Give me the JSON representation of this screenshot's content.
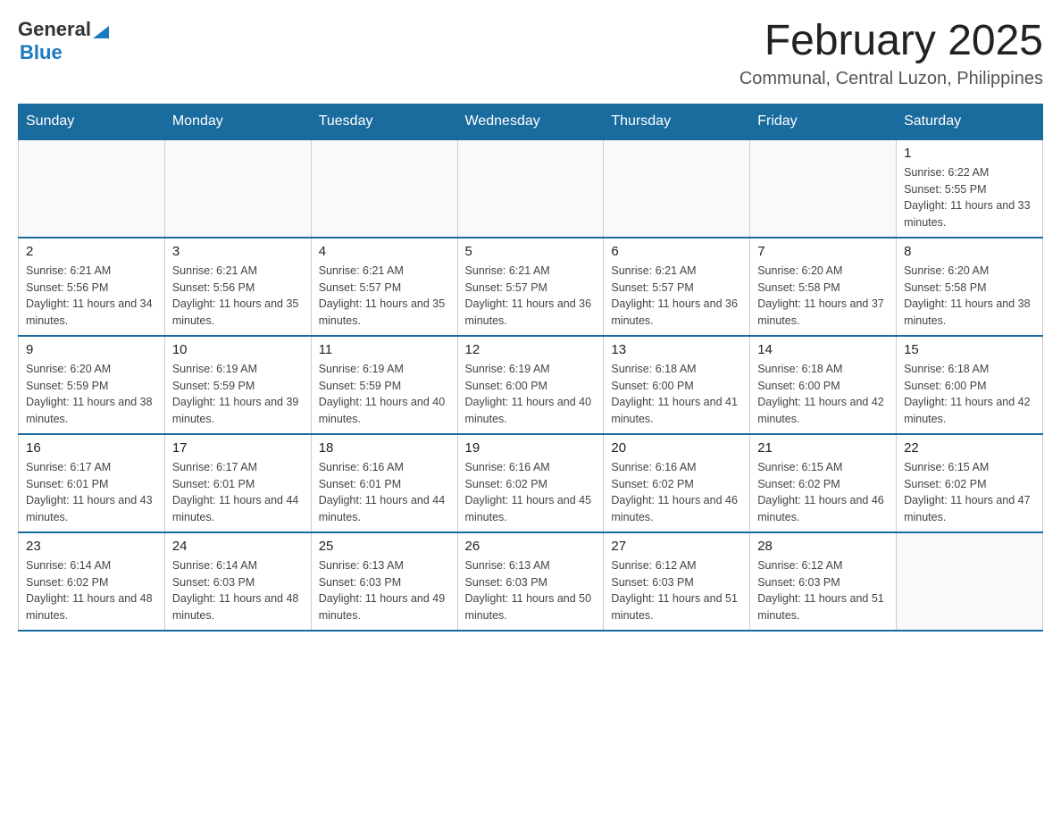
{
  "header": {
    "logo": {
      "general": "General",
      "arrow": "▶",
      "blue": "Blue"
    },
    "title": "February 2025",
    "location": "Communal, Central Luzon, Philippines"
  },
  "calendar": {
    "weekdays": [
      "Sunday",
      "Monday",
      "Tuesday",
      "Wednesday",
      "Thursday",
      "Friday",
      "Saturday"
    ],
    "weeks": [
      [
        {
          "day": "",
          "info": ""
        },
        {
          "day": "",
          "info": ""
        },
        {
          "day": "",
          "info": ""
        },
        {
          "day": "",
          "info": ""
        },
        {
          "day": "",
          "info": ""
        },
        {
          "day": "",
          "info": ""
        },
        {
          "day": "1",
          "info": "Sunrise: 6:22 AM\nSunset: 5:55 PM\nDaylight: 11 hours and 33 minutes."
        }
      ],
      [
        {
          "day": "2",
          "info": "Sunrise: 6:21 AM\nSunset: 5:56 PM\nDaylight: 11 hours and 34 minutes."
        },
        {
          "day": "3",
          "info": "Sunrise: 6:21 AM\nSunset: 5:56 PM\nDaylight: 11 hours and 35 minutes."
        },
        {
          "day": "4",
          "info": "Sunrise: 6:21 AM\nSunset: 5:57 PM\nDaylight: 11 hours and 35 minutes."
        },
        {
          "day": "5",
          "info": "Sunrise: 6:21 AM\nSunset: 5:57 PM\nDaylight: 11 hours and 36 minutes."
        },
        {
          "day": "6",
          "info": "Sunrise: 6:21 AM\nSunset: 5:57 PM\nDaylight: 11 hours and 36 minutes."
        },
        {
          "day": "7",
          "info": "Sunrise: 6:20 AM\nSunset: 5:58 PM\nDaylight: 11 hours and 37 minutes."
        },
        {
          "day": "8",
          "info": "Sunrise: 6:20 AM\nSunset: 5:58 PM\nDaylight: 11 hours and 38 minutes."
        }
      ],
      [
        {
          "day": "9",
          "info": "Sunrise: 6:20 AM\nSunset: 5:59 PM\nDaylight: 11 hours and 38 minutes."
        },
        {
          "day": "10",
          "info": "Sunrise: 6:19 AM\nSunset: 5:59 PM\nDaylight: 11 hours and 39 minutes."
        },
        {
          "day": "11",
          "info": "Sunrise: 6:19 AM\nSunset: 5:59 PM\nDaylight: 11 hours and 40 minutes."
        },
        {
          "day": "12",
          "info": "Sunrise: 6:19 AM\nSunset: 6:00 PM\nDaylight: 11 hours and 40 minutes."
        },
        {
          "day": "13",
          "info": "Sunrise: 6:18 AM\nSunset: 6:00 PM\nDaylight: 11 hours and 41 minutes."
        },
        {
          "day": "14",
          "info": "Sunrise: 6:18 AM\nSunset: 6:00 PM\nDaylight: 11 hours and 42 minutes."
        },
        {
          "day": "15",
          "info": "Sunrise: 6:18 AM\nSunset: 6:00 PM\nDaylight: 11 hours and 42 minutes."
        }
      ],
      [
        {
          "day": "16",
          "info": "Sunrise: 6:17 AM\nSunset: 6:01 PM\nDaylight: 11 hours and 43 minutes."
        },
        {
          "day": "17",
          "info": "Sunrise: 6:17 AM\nSunset: 6:01 PM\nDaylight: 11 hours and 44 minutes."
        },
        {
          "day": "18",
          "info": "Sunrise: 6:16 AM\nSunset: 6:01 PM\nDaylight: 11 hours and 44 minutes."
        },
        {
          "day": "19",
          "info": "Sunrise: 6:16 AM\nSunset: 6:02 PM\nDaylight: 11 hours and 45 minutes."
        },
        {
          "day": "20",
          "info": "Sunrise: 6:16 AM\nSunset: 6:02 PM\nDaylight: 11 hours and 46 minutes."
        },
        {
          "day": "21",
          "info": "Sunrise: 6:15 AM\nSunset: 6:02 PM\nDaylight: 11 hours and 46 minutes."
        },
        {
          "day": "22",
          "info": "Sunrise: 6:15 AM\nSunset: 6:02 PM\nDaylight: 11 hours and 47 minutes."
        }
      ],
      [
        {
          "day": "23",
          "info": "Sunrise: 6:14 AM\nSunset: 6:02 PM\nDaylight: 11 hours and 48 minutes."
        },
        {
          "day": "24",
          "info": "Sunrise: 6:14 AM\nSunset: 6:03 PM\nDaylight: 11 hours and 48 minutes."
        },
        {
          "day": "25",
          "info": "Sunrise: 6:13 AM\nSunset: 6:03 PM\nDaylight: 11 hours and 49 minutes."
        },
        {
          "day": "26",
          "info": "Sunrise: 6:13 AM\nSunset: 6:03 PM\nDaylight: 11 hours and 50 minutes."
        },
        {
          "day": "27",
          "info": "Sunrise: 6:12 AM\nSunset: 6:03 PM\nDaylight: 11 hours and 51 minutes."
        },
        {
          "day": "28",
          "info": "Sunrise: 6:12 AM\nSunset: 6:03 PM\nDaylight: 11 hours and 51 minutes."
        },
        {
          "day": "",
          "info": ""
        }
      ]
    ]
  }
}
